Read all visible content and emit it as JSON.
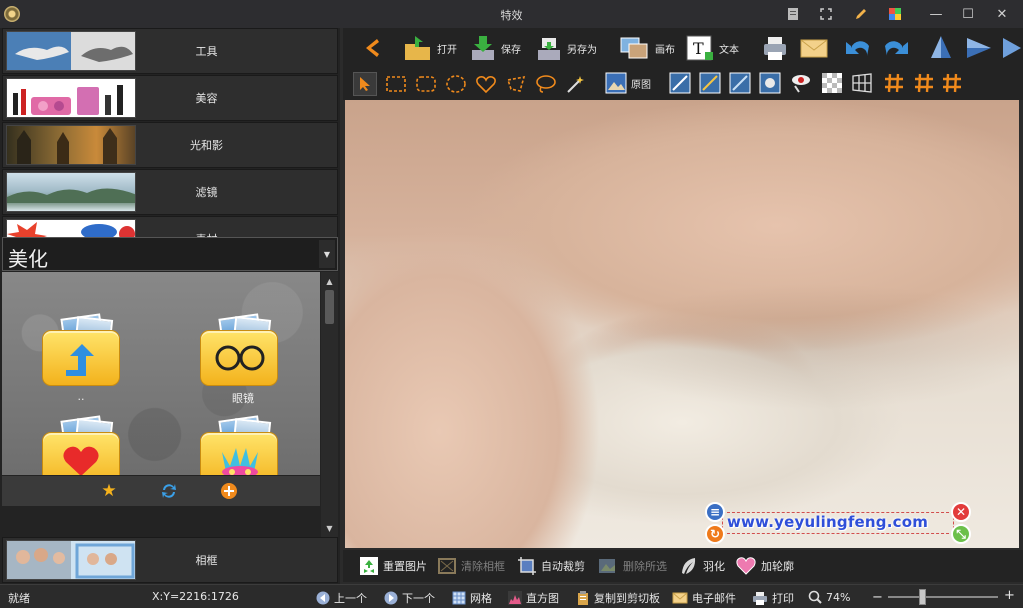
{
  "window": {
    "title": "特效"
  },
  "categories": [
    {
      "label": "工具"
    },
    {
      "label": "美容"
    },
    {
      "label": "光和影"
    },
    {
      "label": "滤镜"
    },
    {
      "label": "素材"
    }
  ],
  "dropdown": {
    "value": "美化"
  },
  "folders": [
    {
      "label": ".."
    },
    {
      "label": "眼镜"
    },
    {
      "label": "爱心"
    },
    {
      "label": "面具"
    }
  ],
  "frame_category": {
    "label": "相框"
  },
  "toolbar": {
    "open": "打开",
    "save": "保存",
    "save_as": "另存为",
    "canvas": "画布",
    "text": "文本",
    "original": "原图"
  },
  "canvas": {
    "watermark": "www.yeyulingfeng.com"
  },
  "actions": {
    "reset": "重置图片",
    "clear_frame": "清除相框",
    "auto_crop": "自动裁剪",
    "delete_selection": "删除所选",
    "feather": "羽化",
    "add_outline": "加轮廓"
  },
  "status": {
    "ready": "就绪",
    "coords": "X:Y=2216:1726",
    "prev": "上一个",
    "next": "下一个",
    "grid": "网格",
    "histogram": "直方图",
    "copy_clipboard": "复制到剪切板",
    "email": "电子邮件",
    "print": "打印",
    "zoom": "74%"
  },
  "colors": {
    "accent_orange": "#f08a1c",
    "accent_blue": "#3b8fd8",
    "folder_yellow": "#f6c230"
  }
}
